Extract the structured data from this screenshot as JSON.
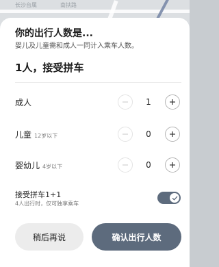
{
  "map": {
    "labels": [
      "长沙台属",
      "南扶路"
    ]
  },
  "sheet": {
    "title": "你的出行人数是...",
    "subtitle": "婴儿及儿童需和成人一同计入乘车人数。",
    "summary": "1人，接受拼车"
  },
  "passengers": {
    "adult": {
      "label": "成人",
      "note": "",
      "count": "1"
    },
    "child": {
      "label": "儿童",
      "note": "12岁以下",
      "count": "0"
    },
    "infant": {
      "label": "婴幼儿",
      "note": "4岁以下",
      "count": "0"
    }
  },
  "carpool": {
    "label": "接受拼车1+1",
    "sublabel": "4人出行时，仅可独享乘车",
    "enabled": true
  },
  "buttons": {
    "later": "稍后再说",
    "confirm": "确认出行人数"
  },
  "colors": {
    "accent": "#5d6b7d",
    "secondary_button": "#ececec"
  }
}
